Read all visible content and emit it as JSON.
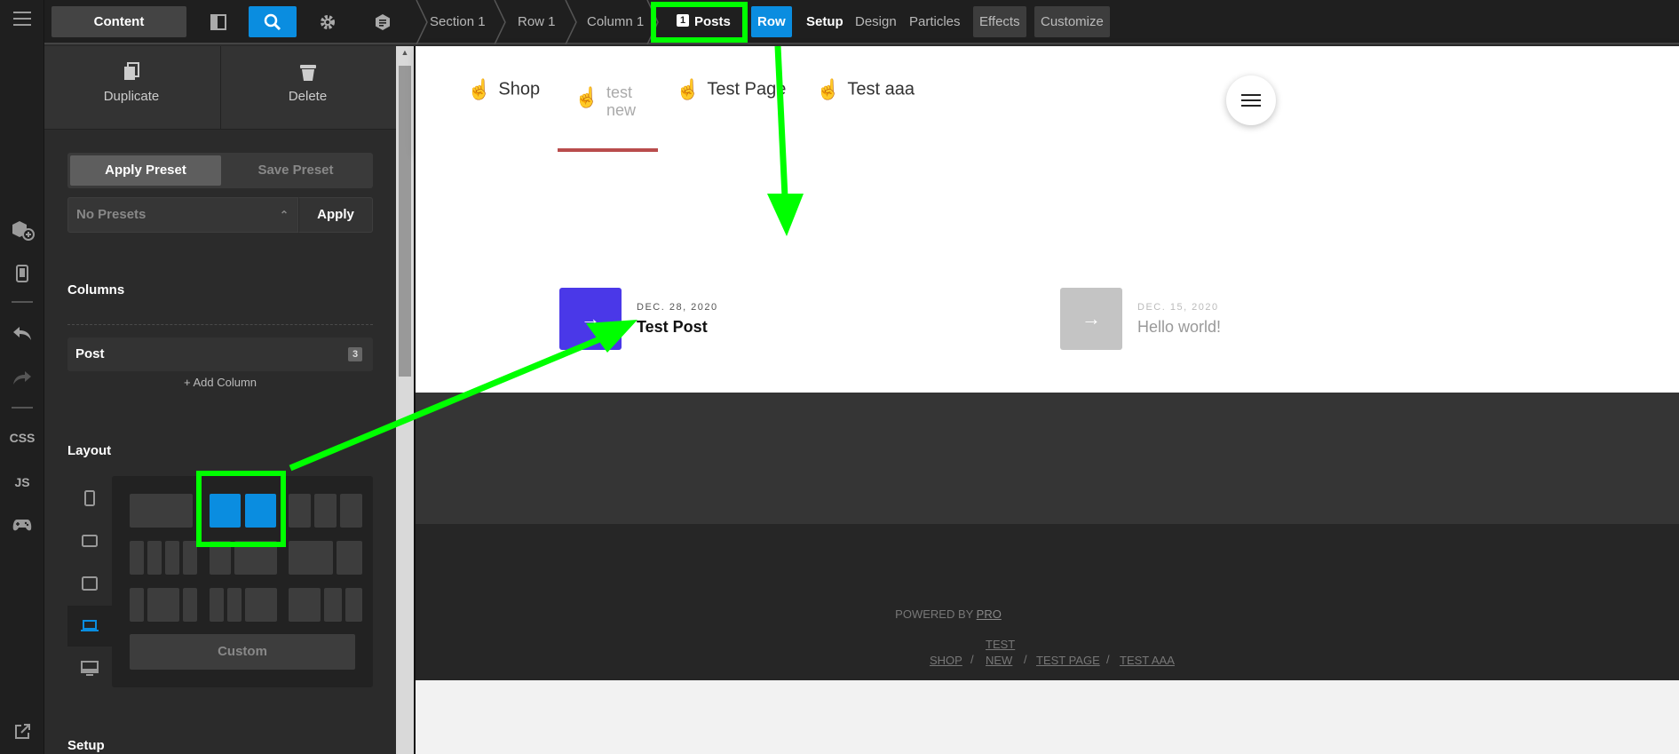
{
  "topbar": {
    "content_label": "Content",
    "breadcrumbs": [
      "Section 1",
      "Row 1",
      "Column 1"
    ],
    "current_badge": "1",
    "current_label": "Posts",
    "tabs": [
      "Row",
      "Setup",
      "Design",
      "Particles",
      "Effects",
      "Customize"
    ]
  },
  "rail": {
    "css_label": "CSS",
    "js_label": "JS"
  },
  "panel": {
    "duplicate_label": "Duplicate",
    "delete_label": "Delete",
    "apply_preset_label": "Apply Preset",
    "save_preset_label": "Save Preset",
    "preset_select_value": "No Presets",
    "apply_label": "Apply",
    "columns_title": "Columns",
    "column_item": "Post",
    "column_count": "3",
    "add_column_label": "+ Add Column",
    "layout_title": "Layout",
    "custom_label": "Custom",
    "setup_title": "Setup"
  },
  "preview": {
    "nav": [
      {
        "label": "Shop"
      },
      {
        "label_line1": "test",
        "label_line2": "new"
      },
      {
        "label": "Test Page"
      },
      {
        "label": "Test aaa"
      }
    ],
    "posts": [
      {
        "date": "DEC. 28, 2020",
        "title": "Test Post",
        "color": "#4a38e8"
      },
      {
        "date": "DEC. 15, 2020",
        "title": "Hello world!",
        "color": "#c4c4c4"
      }
    ],
    "powered_prefix": "POWERED BY ",
    "powered_link": "PRO",
    "footer_links": [
      "SHOP",
      "TEST",
      "NEW",
      "TEST PAGE",
      "TEST AAA"
    ],
    "footer_sep": "/"
  },
  "colors": {
    "accent": "#0a8de0",
    "highlight": "#00ff00",
    "post_accent": "#4a38e8",
    "nav_underline": "#b94c4c"
  }
}
